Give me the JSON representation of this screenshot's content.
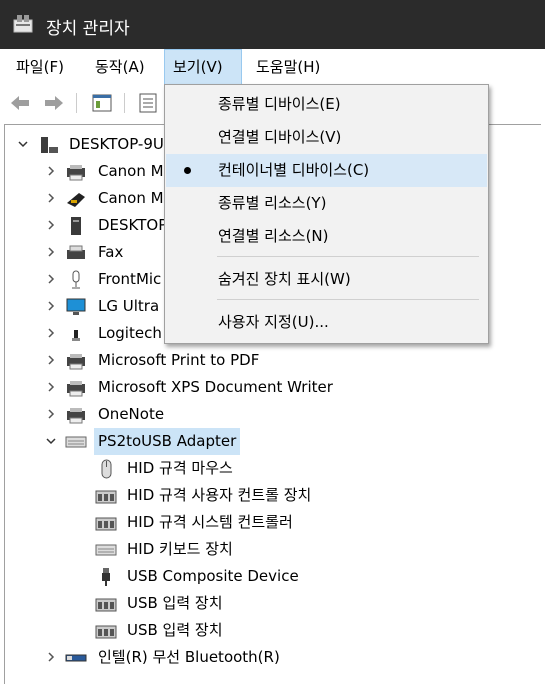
{
  "window": {
    "title": "장치 관리자"
  },
  "menubar": {
    "items": [
      "파일(F)",
      "동작(A)",
      "보기(V)",
      "도움말(H)"
    ]
  },
  "view_menu": {
    "items": [
      "종류별 디바이스(E)",
      "연결별 디바이스(V)",
      "컨테이너별 디바이스(C)",
      "종류별 리소스(Y)",
      "연결별 리소스(N)",
      "숨겨진 장치 표시(W)",
      "사용자 지정(U)..."
    ],
    "checked_item": "컨테이너별 디바이스(C)"
  },
  "tree": {
    "root": "DESKTOP-9U",
    "nodes": [
      "Canon M",
      "Canon M",
      "DESKTOP",
      "Fax",
      "FrontMic",
      "LG Ultra",
      "Logitech",
      "Microsoft Print to PDF",
      "Microsoft XPS Document Writer",
      "OneNote",
      "PS2toUSB Adapter"
    ],
    "children": [
      "HID 규격 마우스",
      "HID 규격 사용자 컨트롤 장치",
      "HID 규격 시스템 컨트롤러",
      "HID 키보드 장치",
      "USB Composite Device",
      "USB 입력 장치",
      "USB 입력 장치"
    ],
    "last_node": "인텔(R) 무선 Bluetooth(R)"
  },
  "colors": {
    "titlebar": "#2b2b2b",
    "selection": "#cce4f7",
    "menu_bg": "#f2f2f2"
  }
}
